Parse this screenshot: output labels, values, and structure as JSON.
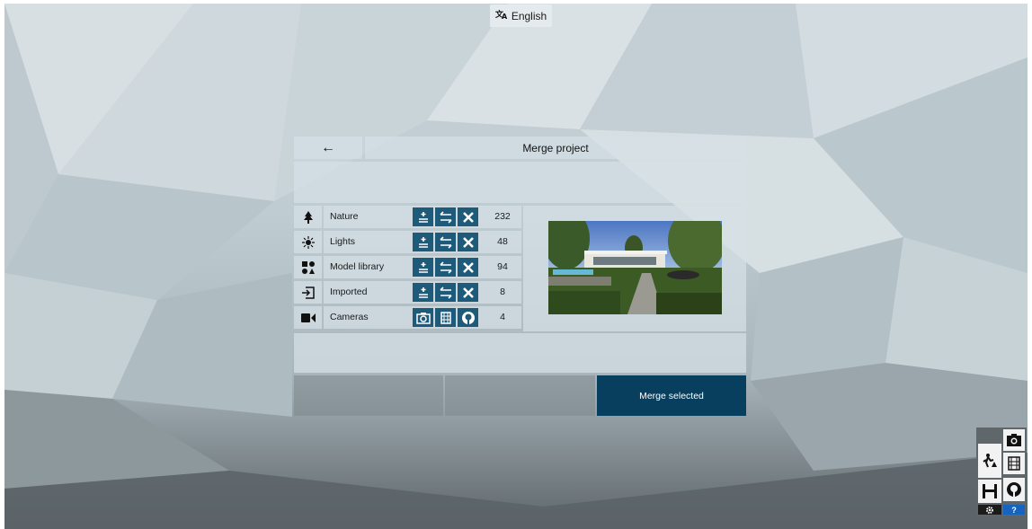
{
  "language": {
    "label": "English"
  },
  "dialog": {
    "back_arrow": "←",
    "title": "Merge project",
    "rows": [
      {
        "label": "Nature",
        "icon": "tree-icon",
        "count": "232",
        "actions": [
          "add-icon",
          "replace-icon",
          "remove-icon"
        ]
      },
      {
        "label": "Lights",
        "icon": "light-icon",
        "count": "48",
        "actions": [
          "add-icon",
          "replace-icon",
          "remove-icon"
        ]
      },
      {
        "label": "Model library",
        "icon": "shapes-icon",
        "count": "94",
        "actions": [
          "add-icon",
          "replace-icon",
          "remove-icon"
        ]
      },
      {
        "label": "Imported",
        "icon": "import-icon",
        "count": "8",
        "actions": [
          "add-icon",
          "replace-icon",
          "remove-icon"
        ]
      },
      {
        "label": "Cameras",
        "icon": "video-camera-icon",
        "count": "4",
        "actions": [
          "photo-camera-icon",
          "film-icon",
          "panorama-icon"
        ]
      }
    ],
    "merge_button": "Merge selected"
  },
  "toolbox": {
    "icons": [
      "build-mode-icon",
      "photo-mode-icon",
      "video-mode-icon",
      "save-icon",
      "panorama-mode-icon",
      "settings-icon",
      "help-icon"
    ],
    "help_label": "?"
  },
  "colors": {
    "accent": "#083f5e",
    "action": "#1e5a7a",
    "help": "#1565c0"
  }
}
